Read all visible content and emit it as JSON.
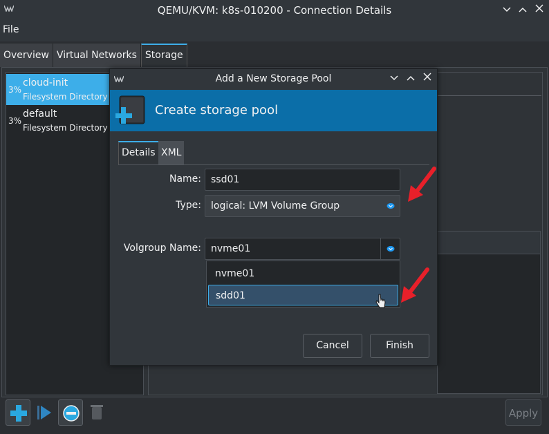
{
  "window": {
    "title": "QEMU/KVM: k8s-010200 - Connection Details",
    "controls": [
      "⌄",
      "⌃",
      "✕"
    ]
  },
  "menubar": {
    "file": "File"
  },
  "main_tabs": [
    {
      "label": "Overview"
    },
    {
      "label": "Virtual Networks"
    },
    {
      "label": "Storage"
    }
  ],
  "pools": [
    {
      "percent": "3%",
      "name": "cloud-init",
      "type": "Filesystem Directory"
    },
    {
      "percent": "3%",
      "name": "default",
      "type": "Filesystem Directory"
    }
  ],
  "toolbar": {
    "apply": "Apply"
  },
  "dialog": {
    "title": "Add a New Storage Pool",
    "header": "Create storage pool",
    "tabs": [
      {
        "label": "Details"
      },
      {
        "label": "XML"
      }
    ],
    "name_label": "Name:",
    "name_value": "ssd01",
    "type_label": "Type:",
    "type_value": "logical: LVM Volume Group",
    "volgroup_label": "Volgroup Name:",
    "volgroup_value": "nvme01",
    "volgroup_options": [
      "nvme01",
      "sdd01"
    ],
    "cancel": "Cancel",
    "finish": "Finish"
  },
  "colors": {
    "accent": "#3daee9",
    "header_blue": "#0b6ea8",
    "arrow_red": "#e8202a"
  }
}
